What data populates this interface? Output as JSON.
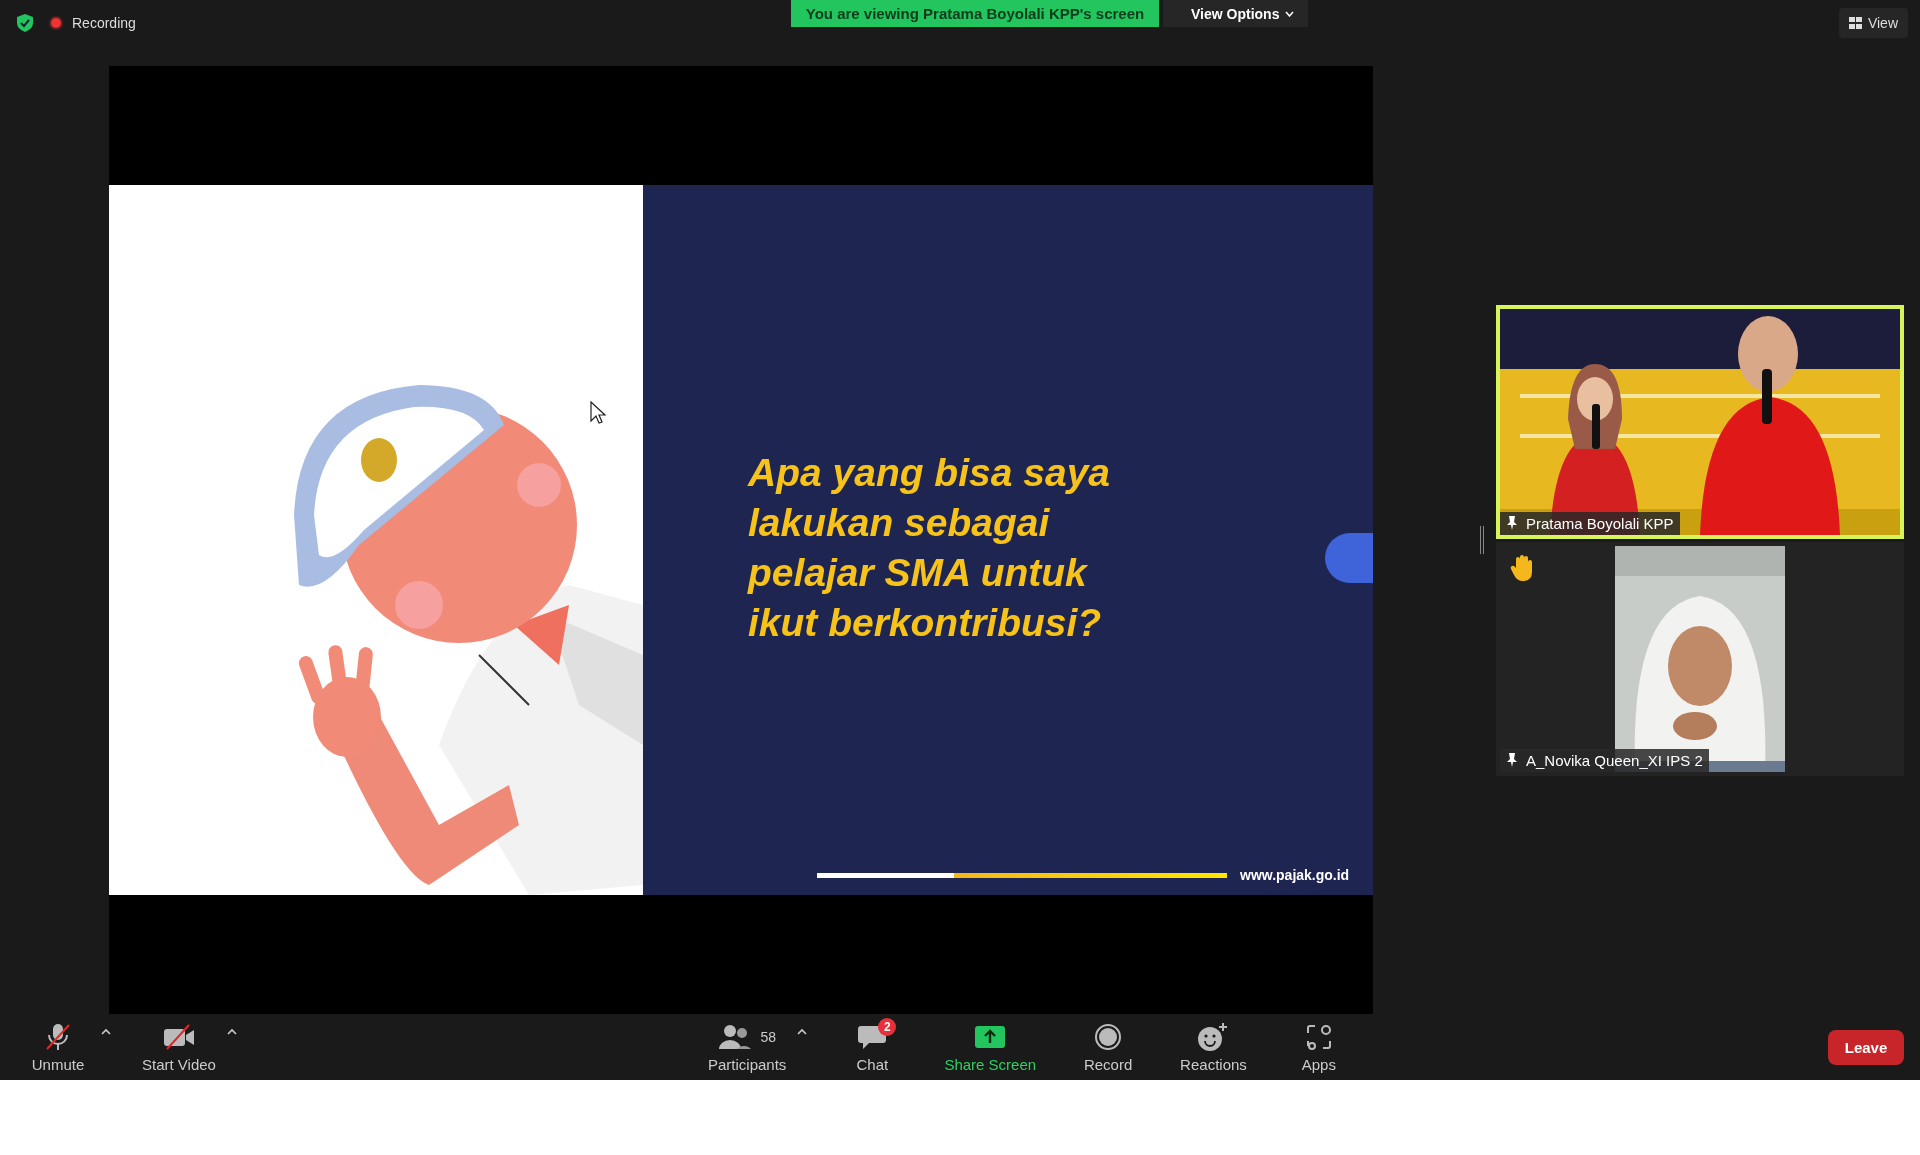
{
  "top_bar": {
    "recording_label": "Recording",
    "sharing_banner": "You are viewing Pratama Boyolali KPP's screen",
    "view_options": "View Options",
    "view_button": "View"
  },
  "slide": {
    "question_lines": [
      "Apa yang bisa saya",
      "lakukan sebagai",
      "pelajar SMA untuk",
      "ikut berkontribusi?"
    ],
    "website": "www.pajak.go.id"
  },
  "videos": [
    {
      "name": "Pratama Boyolali KPP",
      "active": true,
      "hand_raised": false,
      "kind": "studio"
    },
    {
      "name": "A_Novika Queen_XI IPS 2",
      "active": false,
      "hand_raised": true,
      "kind": "portrait"
    }
  ],
  "toolbar": {
    "items": [
      {
        "label": "Unmute",
        "kind": "microphone",
        "off": true,
        "menu": true,
        "highlighted": false
      },
      {
        "label": "Start Video",
        "kind": "camera",
        "off": true,
        "menu": true,
        "highlighted": false
      },
      {
        "label": "Participants",
        "kind": "participants",
        "count": "58",
        "menu": true,
        "highlighted": false
      },
      {
        "label": "Chat",
        "kind": "chat",
        "badge": "2",
        "menu": false,
        "highlighted": false
      },
      {
        "label": "Share Screen",
        "kind": "share",
        "menu": false,
        "highlighted": true
      },
      {
        "label": "Record",
        "kind": "record",
        "menu": false,
        "highlighted": false
      },
      {
        "label": "Reactions",
        "kind": "reactions",
        "menu": false,
        "highlighted": false
      },
      {
        "label": "Apps",
        "kind": "apps",
        "menu": false,
        "highlighted": false
      }
    ],
    "leave": "Leave"
  }
}
